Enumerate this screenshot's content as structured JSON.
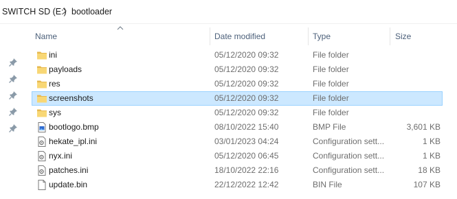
{
  "breadcrumb": {
    "drive": "SWITCH SD (E:)",
    "folder": "bootloader"
  },
  "columns": {
    "name": "Name",
    "date": "Date modified",
    "type": "Type",
    "size": "Size"
  },
  "sort": {
    "column": "name",
    "direction": "ascending"
  },
  "quick_access_pins": 5,
  "files": [
    {
      "name": "ini",
      "date": "05/12/2020 09:32",
      "type": "File folder",
      "size": "",
      "icon": "folder-icon"
    },
    {
      "name": "payloads",
      "date": "05/12/2020 09:32",
      "type": "File folder",
      "size": "",
      "icon": "folder-icon"
    },
    {
      "name": "res",
      "date": "05/12/2020 09:32",
      "type": "File folder",
      "size": "",
      "icon": "folder-icon"
    },
    {
      "name": "screenshots",
      "date": "05/12/2020 09:32",
      "type": "File folder",
      "size": "",
      "icon": "folder-icon",
      "selected": true
    },
    {
      "name": "sys",
      "date": "05/12/2020 09:32",
      "type": "File folder",
      "size": "",
      "icon": "folder-icon"
    },
    {
      "name": "bootlogo.bmp",
      "date": "08/10/2022 15:40",
      "type": "BMP File",
      "size": "3,601 KB",
      "icon": "bitmap-file-icon"
    },
    {
      "name": "hekate_ipl.ini",
      "date": "03/01/2023 04:24",
      "type": "Configuration sett...",
      "size": "1 KB",
      "icon": "config-file-icon"
    },
    {
      "name": "nyx.ini",
      "date": "05/12/2020 06:45",
      "type": "Configuration sett...",
      "size": "1 KB",
      "icon": "config-file-icon"
    },
    {
      "name": "patches.ini",
      "date": "18/10/2022 22:16",
      "type": "Configuration sett...",
      "size": "18 KB",
      "icon": "config-file-icon"
    },
    {
      "name": "update.bin",
      "date": "22/12/2022 12:42",
      "type": "BIN File",
      "size": "107 KB",
      "icon": "blank-file-icon"
    }
  ],
  "colors": {
    "header_text": "#4c607a",
    "selection_fill": "#cce8ff",
    "selection_border": "#99d1ff",
    "folder": "#f8d775",
    "pin": "#8a9aa8"
  }
}
